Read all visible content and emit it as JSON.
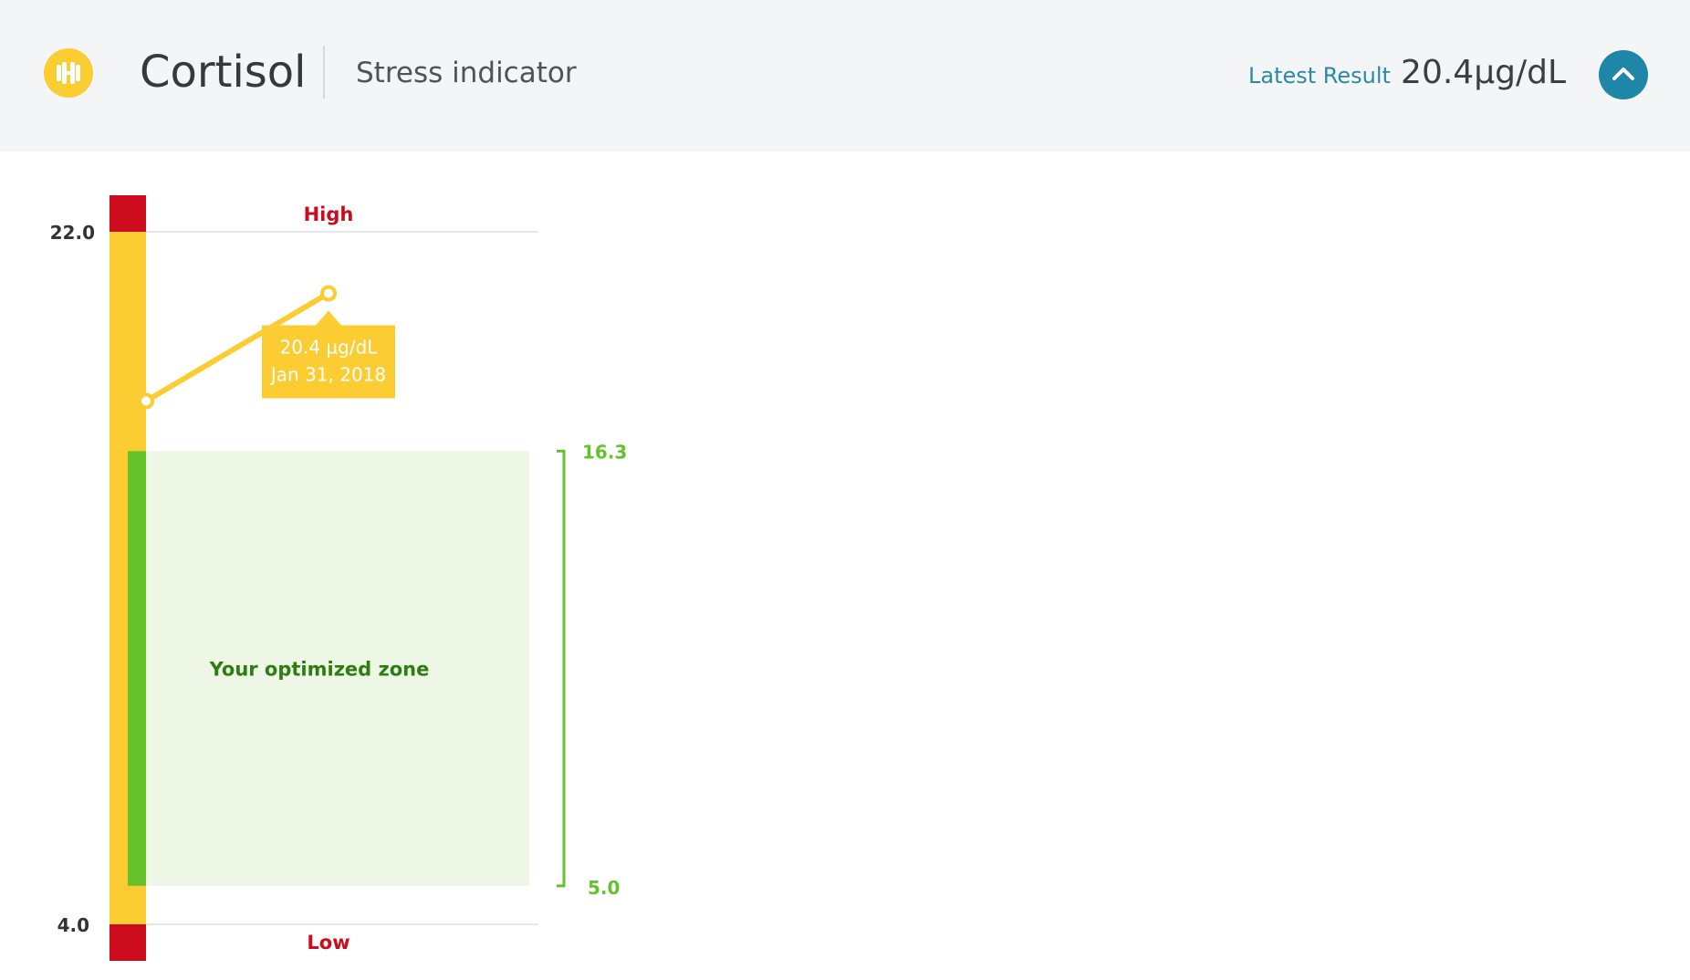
{
  "header": {
    "title": "Cortisol",
    "subtitle": "Stress indicator",
    "latest_label": "Latest Result",
    "latest_value": "20.4µg/dL",
    "badge_icon": "dumbbell-icon",
    "collapse_icon": "chevron-up-icon"
  },
  "colors": {
    "badge": "#fccc33",
    "accent": "#1e86a6",
    "high_low": "#cc0c1c",
    "warning": "#fccc33",
    "optimal": "#66c22a",
    "optimal_fill": "#eef7e5",
    "optimal_text": "#2b7f12"
  },
  "chart_data": {
    "type": "line",
    "ylim": [
      4.0,
      22.0
    ],
    "y_ticks": [
      "22.0",
      "4.0"
    ],
    "high_label": "High",
    "low_label": "Low",
    "optimal_range": {
      "low": 5.0,
      "high": 16.3,
      "low_label": "5.0",
      "high_label": "16.3"
    },
    "optimal_zone_label": "Your optimized zone",
    "series": [
      {
        "points": [
          {
            "y": 17.6
          },
          {
            "y": 20.4
          }
        ]
      }
    ],
    "tooltip": {
      "value": "20.4 µg/dL",
      "date": "Jan 31, 2018"
    }
  }
}
